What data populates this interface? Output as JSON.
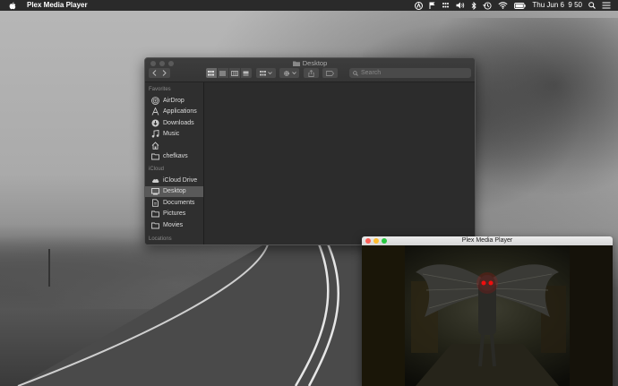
{
  "menubar": {
    "app_name": "Plex Media Player",
    "clock": "Thu Jun 6  9 50",
    "status_icons": [
      "a-icon",
      "flag-icon",
      "dots-icon",
      "volume-icon",
      "bluetooth-icon",
      "time-machine-icon",
      "wifi-icon",
      "battery-icon",
      "search-icon",
      "list-icon"
    ]
  },
  "finder": {
    "title": "Desktop",
    "search_placeholder": "Search",
    "sidebar": {
      "favorites_header": "Favorites",
      "favorites": [
        {
          "label": "AirDrop",
          "icon": "airdrop-icon"
        },
        {
          "label": "Applications",
          "icon": "applications-icon"
        },
        {
          "label": "Downloads",
          "icon": "downloads-icon"
        },
        {
          "label": "Music",
          "icon": "music-icon"
        },
        {
          "label": "",
          "icon": "home-icon"
        },
        {
          "label": "chefkavs",
          "icon": "folder-icon"
        }
      ],
      "icloud_header": "iCloud",
      "icloud": [
        {
          "label": "iCloud Drive",
          "icon": "cloud-icon"
        },
        {
          "label": "Desktop",
          "icon": "desktop-icon",
          "selected": true
        },
        {
          "label": "Documents",
          "icon": "documents-icon"
        },
        {
          "label": "Pictures",
          "icon": "folder-icon"
        },
        {
          "label": "Movies",
          "icon": "folder-icon"
        }
      ],
      "locations_header": "Locations"
    }
  },
  "plex": {
    "title": "Plex Media Player"
  }
}
